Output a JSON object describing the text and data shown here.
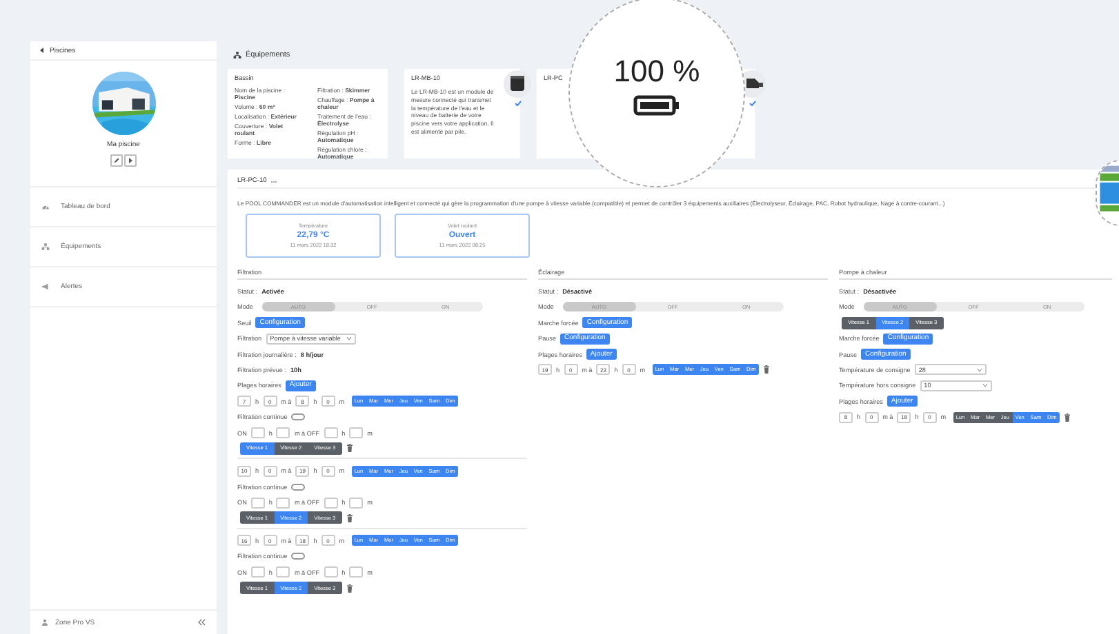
{
  "sidebar": {
    "title": "Piscines",
    "pool_name": "Ma piscine",
    "nav": [
      "Tableau de bord",
      "Équipements",
      "Alertes"
    ],
    "footer": "Zone Pro VS"
  },
  "equipment": {
    "title": "Équipements",
    "cards": [
      {
        "kind": "info",
        "title": "Bassin",
        "columns": [
          [
            "Nom de la piscine : **Piscine**",
            "Volume : **60 m³**",
            "Localisation : **Extérieur**",
            "Couverture : **Volet roulant**",
            "Forme : **Libre**"
          ],
          [
            "Filtration : **Skimmer**",
            "Chauffage : **Pompe à chaleur**",
            "Traitement de l'eau : **Électrolyse**",
            "Régulation pH : **Automatique**",
            "Régulation chlore : **Automatique**"
          ]
        ]
      },
      {
        "kind": "device",
        "title": "LR-MB-10",
        "text": "Le LR-MB-10 est un module de mesure connecté qui transmet la température de l'eau et le niveau de batterie de votre piscine vers votre application. Il est alimenté par pile.",
        "checked": true
      },
      {
        "kind": "device",
        "title": "LR-PC",
        "checked": true
      }
    ],
    "lens": {
      "reading": "100 %"
    }
  },
  "controller": {
    "title": "LR-PC-10",
    "description": "Le POOL COMMANDER est un module d'automatisation intelligent et connecté qui gère la programmation d'une pompe à vitesse variable (compatible) et permet de contrôler 3 équipements auxiliaires (Électrolyseur, Éclairage, PAC, Robot hydraulique, Nage à contre-courant...)",
    "stats": [
      {
        "label": "Température",
        "value": "22,79 °C",
        "time": "11 mars 2022 18:32"
      },
      {
        "label": "Volet roulant",
        "value": "Ouvert",
        "time": "11 mars 2022 08:25"
      }
    ],
    "columns": [
      {
        "title": "Filtration",
        "rows": [
          {
            "kind": "status",
            "label": "Statut :",
            "value": "Activée"
          },
          {
            "kind": "mode",
            "label": "Mode",
            "options": [
              {
                "label": "AUTO",
                "selected": true
              },
              {
                "label": "OFF",
                "selected": false
              },
              {
                "label": "ON",
                "selected": false
              }
            ]
          },
          {
            "kind": "button",
            "label": "Seuil",
            "button": "Configuration"
          },
          {
            "kind": "select",
            "label": "Filtration",
            "value": "Pompe à vitesse variable"
          },
          {
            "kind": "text",
            "label": "Filtration journalière :",
            "value": "8 h/jour"
          },
          {
            "kind": "text",
            "label": "Filtration prévue :",
            "value": "10h"
          },
          {
            "kind": "button",
            "label": "Plages horaires",
            "button": "Ajouter"
          },
          {
            "kind": "line",
            "items": [
              {
                "kind": "field",
                "value": "7"
              },
              {
                "kind": "text",
                "value": "h"
              },
              {
                "kind": "field",
                "value": "0"
              },
              {
                "kind": "text",
                "value": "m à"
              },
              {
                "kind": "field",
                "value": "8"
              },
              {
                "kind": "text",
                "value": "h"
              },
              {
                "kind": "field",
                "value": "0"
              },
              {
                "kind": "text",
                "value": "m"
              },
              {
                "kind": "days",
                "options": [
                  {
                    "label": "Lun",
                    "selected": true
                  },
                  {
                    "label": "Mar",
                    "selected": true
                  },
                  {
                    "label": "Mer",
                    "selected": true
                  },
                  {
                    "label": "Jeu",
                    "selected": true
                  },
                  {
                    "label": "Ven",
                    "selected": true
                  },
                  {
                    "label": "Sam",
                    "selected": true
                  },
                  {
                    "label": "Dim",
                    "selected": true
                  }
                ]
              }
            ]
          },
          {
            "kind": "toggle",
            "label": "Filtration continue",
            "on": false
          },
          {
            "kind": "line",
            "items": [
              {
                "kind": "text",
                "value": "ON"
              },
              {
                "kind": "field"
              },
              {
                "kind": "text",
                "value": "h"
              },
              {
                "kind": "field"
              },
              {
                "kind": "text",
                "value": "m à OFF"
              },
              {
                "kind": "field"
              },
              {
                "kind": "text",
                "value": "h"
              },
              {
                "kind": "field"
              },
              {
                "kind": "text",
                "value": "m"
              }
            ]
          },
          {
            "kind": "line",
            "items": [
              {
                "kind": "speeds",
                "options": [
                  {
                    "label": "Vitesse 1",
                    "selected": true
                  },
                  {
                    "label": "Vitesse 2",
                    "selected": false
                  },
                  {
                    "label": "Vitesse 3",
                    "selected": false
                  }
                ]
              },
              {
                "kind": "trash"
              }
            ]
          },
          {
            "kind": "divider"
          },
          {
            "kind": "line",
            "items": [
              {
                "kind": "field",
                "value": "10"
              },
              {
                "kind": "text",
                "value": "h"
              },
              {
                "kind": "field",
                "value": "0"
              },
              {
                "kind": "text",
                "value": "m à"
              },
              {
                "kind": "field",
                "value": "19"
              },
              {
                "kind": "text",
                "value": "h"
              },
              {
                "kind": "field",
                "value": "0"
              },
              {
                "kind": "text",
                "value": "m"
              },
              {
                "kind": "days",
                "options": [
                  {
                    "label": "Lun",
                    "selected": true
                  },
                  {
                    "label": "Mar",
                    "selected": true
                  },
                  {
                    "label": "Mer",
                    "selected": true
                  },
                  {
                    "label": "Jeu",
                    "selected": true
                  },
                  {
                    "label": "Ven",
                    "selected": true
                  },
                  {
                    "label": "Sam",
                    "selected": true
                  },
                  {
                    "label": "Dim",
                    "selected": true
                  }
                ]
              }
            ]
          },
          {
            "kind": "toggle",
            "label": "Filtration continue",
            "on": false
          },
          {
            "kind": "line",
            "items": [
              {
                "kind": "text",
                "value": "ON"
              },
              {
                "kind": "field"
              },
              {
                "kind": "text",
                "value": "h"
              },
              {
                "kind": "field"
              },
              {
                "kind": "text",
                "value": "m à OFF"
              },
              {
                "kind": "field"
              },
              {
                "kind": "text",
                "value": "h"
              },
              {
                "kind": "field"
              },
              {
                "kind": "text",
                "value": "m"
              }
            ]
          },
          {
            "kind": "line",
            "items": [
              {
                "kind": "speeds",
                "options": [
                  {
                    "label": "Vitesse 1",
                    "selected": false
                  },
                  {
                    "label": "Vitesse 2",
                    "selected": true
                  },
                  {
                    "label": "Vitesse 3",
                    "selected": false
                  }
                ]
              },
              {
                "kind": "trash"
              }
            ]
          },
          {
            "kind": "divider"
          },
          {
            "kind": "line",
            "items": [
              {
                "kind": "field",
                "value": "16"
              },
              {
                "kind": "text",
                "value": "h"
              },
              {
                "kind": "field",
                "value": "0"
              },
              {
                "kind": "text",
                "value": "m à"
              },
              {
                "kind": "field",
                "value": "18"
              },
              {
                "kind": "text",
                "value": "h"
              },
              {
                "kind": "field",
                "value": "0"
              },
              {
                "kind": "text",
                "value": "m"
              },
              {
                "kind": "days",
                "options": [
                  {
                    "label": "Lun",
                    "selected": true
                  },
                  {
                    "label": "Mar",
                    "selected": true
                  },
                  {
                    "label": "Mer",
                    "selected": true
                  },
                  {
                    "label": "Jeu",
                    "selected": true
                  },
                  {
                    "label": "Ven",
                    "selected": true
                  },
                  {
                    "label": "Sam",
                    "selected": true
                  },
                  {
                    "label": "Dim",
                    "selected": true
                  }
                ]
              }
            ]
          },
          {
            "kind": "toggle",
            "label": "Filtration continue",
            "on": false
          },
          {
            "kind": "line",
            "items": [
              {
                "kind": "text",
                "value": "ON"
              },
              {
                "kind": "field"
              },
              {
                "kind": "text",
                "value": "h"
              },
              {
                "kind": "field"
              },
              {
                "kind": "text",
                "value": "m à OFF"
              },
              {
                "kind": "field"
              },
              {
                "kind": "text",
                "value": "h"
              },
              {
                "kind": "field"
              },
              {
                "kind": "text",
                "value": "m"
              }
            ]
          },
          {
            "kind": "line",
            "items": [
              {
                "kind": "speeds",
                "options": [
                  {
                    "label": "Vitesse 1",
                    "selected": false
                  },
                  {
                    "label": "Vitesse 2",
                    "selected": true
                  },
                  {
                    "label": "Vitesse 3",
                    "selected": false
                  }
                ]
              },
              {
                "kind": "trash"
              }
            ]
          }
        ]
      },
      {
        "title": "Éclairage",
        "rows": [
          {
            "kind": "status",
            "label": "Statut :",
            "value": "Désactivé"
          },
          {
            "kind": "mode",
            "label": "Mode",
            "options": [
              {
                "label": "AUTO",
                "selected": true
              },
              {
                "label": "OFF",
                "selected": false
              },
              {
                "label": "ON",
                "selected": false
              }
            ]
          },
          {
            "kind": "button",
            "label": "Marche forcée",
            "button": "Configuration"
          },
          {
            "kind": "button",
            "label": "Pause",
            "button": "Configuration"
          },
          {
            "kind": "button",
            "label": "Plages horaires",
            "button": "Ajouter"
          },
          {
            "kind": "line",
            "items": [
              {
                "kind": "field",
                "value": "19"
              },
              {
                "kind": "text",
                "value": "h"
              },
              {
                "kind": "field",
                "value": "0"
              },
              {
                "kind": "text",
                "value": "m à"
              },
              {
                "kind": "field",
                "value": "23"
              },
              {
                "kind": "text",
                "value": "h"
              },
              {
                "kind": "field",
                "value": "0"
              },
              {
                "kind": "text",
                "value": "m"
              },
              {
                "kind": "days",
                "options": [
                  {
                    "label": "Lun",
                    "selected": true
                  },
                  {
                    "label": "Mar",
                    "selected": true
                  },
                  {
                    "label": "Mer",
                    "selected": true
                  },
                  {
                    "label": "Jeu",
                    "selected": true
                  },
                  {
                    "label": "Ven",
                    "selected": true
                  },
                  {
                    "label": "Sam",
                    "selected": true
                  },
                  {
                    "label": "Dim",
                    "selected": true
                  }
                ]
              },
              {
                "kind": "trash"
              }
            ]
          }
        ]
      },
      {
        "title": "Pompe à chaleur",
        "rows": [
          {
            "kind": "status",
            "label": "Statut :",
            "value": "Désactivée"
          },
          {
            "kind": "mode",
            "label": "Mode",
            "options": [
              {
                "label": "AUTO",
                "selected": true
              },
              {
                "label": "OFF",
                "selected": false
              },
              {
                "label": "ON",
                "selected": false
              }
            ]
          },
          {
            "kind": "line",
            "items": [
              {
                "kind": "speeds",
                "options": [
                  {
                    "label": "Vitesse 1",
                    "selected": false
                  },
                  {
                    "label": "Vitesse 2",
                    "selected": true
                  },
                  {
                    "label": "Vitesse 3",
                    "selected": false
                  }
                ]
              }
            ]
          },
          {
            "kind": "button",
            "label": "Marche forcée",
            "button": "Configuration"
          },
          {
            "kind": "button",
            "label": "Pause",
            "button": "Configuration"
          },
          {
            "kind": "select",
            "label": "Température de consigne",
            "value": "28"
          },
          {
            "kind": "select",
            "label": "Température hors consigne",
            "value": "10"
          },
          {
            "kind": "button",
            "label": "Plages horaires",
            "button": "Ajouter"
          },
          {
            "kind": "line",
            "items": [
              {
                "kind": "field",
                "value": "8"
              },
              {
                "kind": "text",
                "value": "h"
              },
              {
                "kind": "field",
                "value": "0"
              },
              {
                "kind": "text",
                "value": "m à"
              },
              {
                "kind": "field",
                "value": "18"
              },
              {
                "kind": "text",
                "value": "h"
              },
              {
                "kind": "field",
                "value": "0"
              },
              {
                "kind": "text",
                "value": "m"
              },
              {
                "kind": "days",
                "options": [
                  {
                    "label": "Lun",
                    "selected": false
                  },
                  {
                    "label": "Mar",
                    "selected": false
                  },
                  {
                    "label": "Mer",
                    "selected": false
                  },
                  {
                    "label": "Jeu",
                    "selected": false
                  },
                  {
                    "label": "Ven",
                    "selected": true
                  },
                  {
                    "label": "Sam",
                    "selected": true
                  },
                  {
                    "label": "Dim",
                    "selected": true
                  }
                ]
              },
              {
                "kind": "trash"
              }
            ]
          }
        ]
      }
    ]
  }
}
